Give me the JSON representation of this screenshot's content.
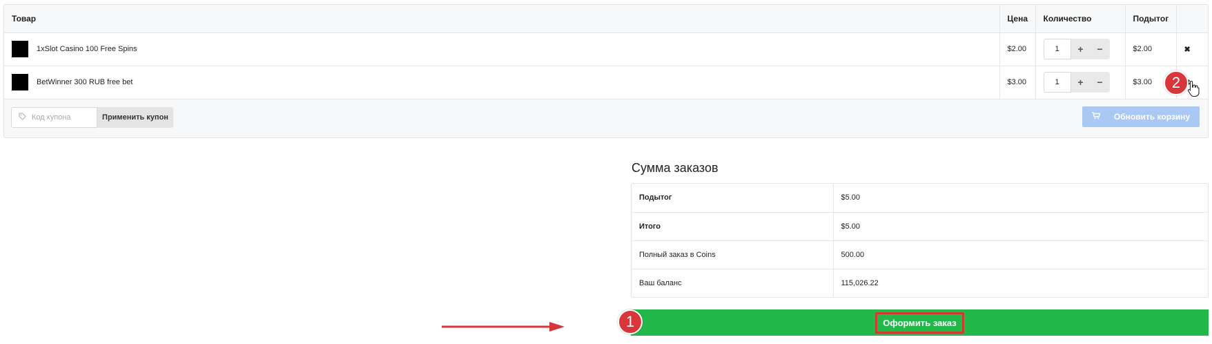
{
  "cart": {
    "headers": {
      "product": "Товар",
      "price": "Цена",
      "quantity": "Количество",
      "subtotal": "Подытог"
    },
    "items": [
      {
        "name": "1xSlot Casino 100 Free Spins",
        "price": "$2.00",
        "qty": "1",
        "subtotal": "$2.00"
      },
      {
        "name": "BetWinner 300 RUB free bet",
        "price": "$3.00",
        "qty": "1",
        "subtotal": "$3.00"
      }
    ],
    "qty_plus": "+",
    "qty_minus": "−",
    "remove_glyph": "✖",
    "coupon": {
      "placeholder": "Код купона",
      "apply_label": "Применить купон"
    },
    "update_label": "Обновить корзину"
  },
  "totals": {
    "title": "Сумма заказов",
    "rows": [
      {
        "label": "Подытог",
        "value": "$5.00"
      },
      {
        "label": "Итого",
        "value": "$5.00"
      },
      {
        "label": "Полный заказ в Coins",
        "value": "500.00"
      },
      {
        "label": "Ваш баланс",
        "value": "115,026.22"
      }
    ],
    "checkout_label": "Оформить заказ"
  },
  "annotations": {
    "badge1": "1",
    "badge2": "2"
  },
  "colors": {
    "checkout_bg": "#22b94a",
    "update_bg": "#a9c8f4",
    "remove": "#e04444",
    "badge": "#d8363a",
    "highlight": "#d03b2f"
  },
  "icons": {
    "coupon": "tag-icon",
    "update": "cart-icon",
    "remove": "close-icon",
    "cursor": "hand-pointer-icon",
    "arrow": "arrow-right-icon"
  }
}
